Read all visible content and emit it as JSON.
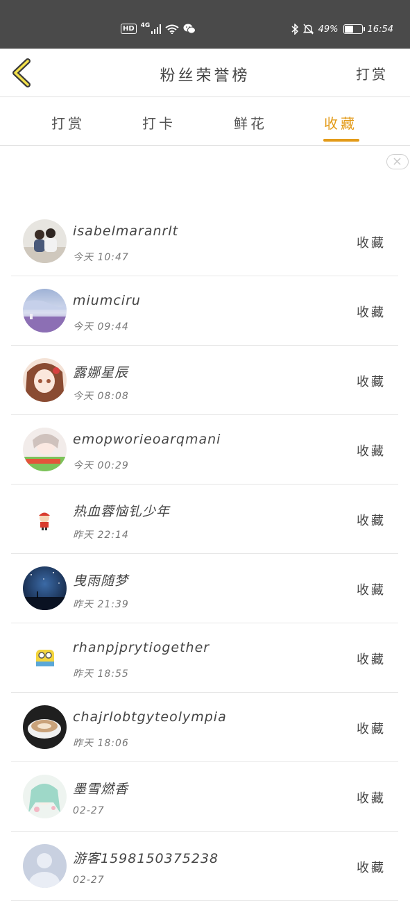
{
  "status_bar": {
    "hd": "HD",
    "network": "4G",
    "battery": "49%",
    "time": "16:54"
  },
  "header": {
    "title": "粉丝荣誉榜",
    "action": "打赏",
    "back_icon": "chevron-left-icon"
  },
  "tabs": [
    {
      "label": "打赏",
      "active": false
    },
    {
      "label": "打卡",
      "active": false
    },
    {
      "label": "鲜花",
      "active": false
    },
    {
      "label": "收藏",
      "active": true
    }
  ],
  "accent_color": "#e39b19",
  "list": [
    {
      "name": "isabelmaranrlt",
      "time": "今天 10:47",
      "action": "收藏"
    },
    {
      "name": "miumciru",
      "time": "今天 09:44",
      "action": "收藏"
    },
    {
      "name": "露娜星辰",
      "time": "今天 08:08",
      "action": "收藏"
    },
    {
      "name": "emopworieoarqmani",
      "time": "今天 00:29",
      "action": "收藏"
    },
    {
      "name": "热血蓉恼钆少年",
      "time": "昨天 22:14",
      "action": "收藏"
    },
    {
      "name": "曳雨随梦",
      "time": "昨天 21:39",
      "action": "收藏"
    },
    {
      "name": "rhanpjprytiogether",
      "time": "昨天 18:55",
      "action": "收藏"
    },
    {
      "name": "chajrlobtgyteolympia",
      "time": "昨天 18:06",
      "action": "收藏"
    },
    {
      "name": "墨雪燃香",
      "time": "02-27",
      "action": "收藏"
    },
    {
      "name": "游客1598150375238",
      "time": "02-27",
      "action": "收藏"
    }
  ]
}
